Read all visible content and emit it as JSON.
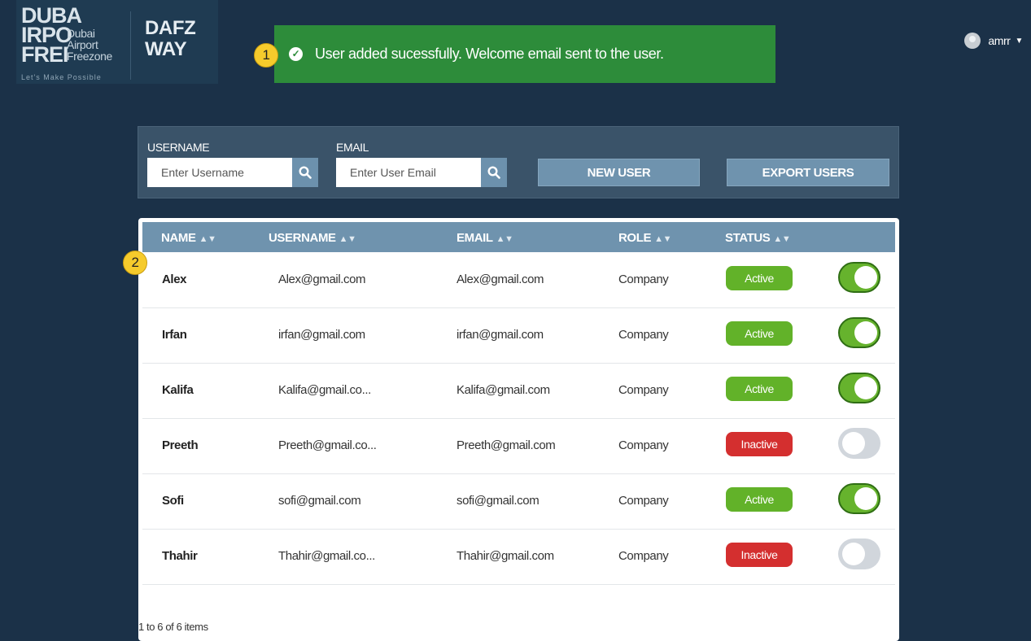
{
  "header": {
    "logo_big": [
      "DUBA",
      "IRPO",
      "FREI"
    ],
    "logo_small": [
      "Dubai",
      "Airport",
      "Freezone"
    ],
    "logo_tag": "Let's Make Possible",
    "product": [
      "DAFZ",
      "WAY"
    ],
    "user_name": "amrr"
  },
  "annotations": {
    "badge1": "1",
    "badge2": "2"
  },
  "toast": {
    "message": "User added sucessfully. Welcome email sent to the user."
  },
  "filters": {
    "username_label": "USERNAME",
    "username_placeholder": "Enter Username",
    "email_label": "EMAIL",
    "email_placeholder": "Enter User Email",
    "new_user": "NEW USER",
    "export_users": "EXPORT USERS"
  },
  "table": {
    "columns": [
      "NAME",
      "USERNAME",
      "EMAIL",
      "ROLE",
      "STATUS"
    ],
    "rows": [
      {
        "name": "Alex",
        "username": "Alex@gmail.com",
        "email": "Alex@gmail.com",
        "role": "Company",
        "status": "Active"
      },
      {
        "name": "Irfan",
        "username": "irfan@gmail.com",
        "email": "irfan@gmail.com",
        "role": "Company",
        "status": "Active"
      },
      {
        "name": "Kalifa",
        "username": "Kalifa@gmail.co...",
        "email": "Kalifa@gmail.com",
        "role": "Company",
        "status": "Active"
      },
      {
        "name": "Preeth",
        "username": "Preeth@gmail.co...",
        "email": "Preeth@gmail.com",
        "role": "Company",
        "status": "Inactive"
      },
      {
        "name": "Sofi",
        "username": "sofi@gmail.com",
        "email": "sofi@gmail.com",
        "role": "Company",
        "status": "Active"
      },
      {
        "name": "Thahir",
        "username": "Thahir@gmail.co...",
        "email": "Thahir@gmail.com",
        "role": "Company",
        "status": "Inactive"
      }
    ],
    "footer": "1 to 6 of 6 items"
  },
  "colors": {
    "accent": "#6f93ae",
    "active": "#62b229",
    "inactive": "#d42f2f",
    "toast": "#2d8c3a"
  }
}
